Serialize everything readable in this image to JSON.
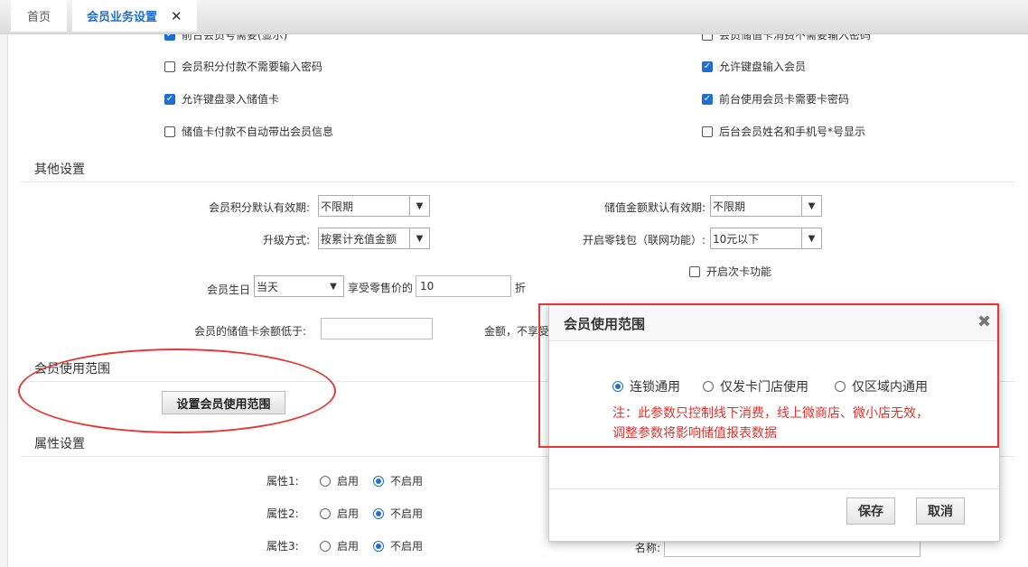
{
  "tabs": {
    "home": "首页",
    "active": "会员业务设置",
    "close": "✕"
  },
  "checkboxes": [
    {
      "label": "前台会员号需要(显示)",
      "checked": true
    },
    {
      "label": "会员储值卡消费不需要输入密码",
      "checked": false
    },
    {
      "label": "会员积分付款不需要输入密码",
      "checked": false
    },
    {
      "label": "允许键盘输入会员",
      "checked": true
    },
    {
      "label": "允许键盘录入储值卡",
      "checked": true
    },
    {
      "label": "前台使用会员卡需要卡密码",
      "checked": true
    },
    {
      "label": "储值卡付款不自动带出会员信息",
      "checked": false
    },
    {
      "label": "后台会员姓名和手机号*号显示",
      "checked": false
    }
  ],
  "other": {
    "title": "其他设置",
    "points_expiry_label": "会员积分默认有效期:",
    "points_expiry_value": "不限期",
    "stored_expiry_label": "储值金额默认有效期:",
    "stored_expiry_value": "不限期",
    "upgrade_label": "升级方式:",
    "upgrade_value": "按累计充值金额",
    "wallet_label": "开启零钱包（联网功能）:",
    "wallet_value": "10元以下",
    "times_card_label": "开启次卡功能",
    "birthday_label": "会员生日",
    "birthday_value": "当天",
    "retail_label": "享受零售价的",
    "retail_value": "10",
    "discount_unit": "折",
    "balance_label": "会员的储值卡余额低于:",
    "balance_value": "",
    "amount_label": "金额，不享受"
  },
  "scope": {
    "title": "会员使用范围",
    "button": "设置会员使用范围"
  },
  "attrs": {
    "title": "属性设置",
    "rows": [
      {
        "label": "属性1:",
        "on": "启用",
        "off": "不启用"
      },
      {
        "label": "属性2:",
        "on": "启用",
        "off": "不启用"
      },
      {
        "label": "属性3:",
        "on": "启用",
        "off": "不启用"
      }
    ],
    "name_label": "名称:"
  },
  "modal": {
    "title": "会员使用范围",
    "close": "✖",
    "options": [
      "连锁通用",
      "仅发卡门店使用",
      "仅区域内通用"
    ],
    "selected": 0,
    "note_line1": "注：此参数只控制线下消费，线上微商店、微小店无效，",
    "note_line2": "调整参数将影响储值报表数据",
    "save": "保存",
    "cancel": "取消"
  }
}
